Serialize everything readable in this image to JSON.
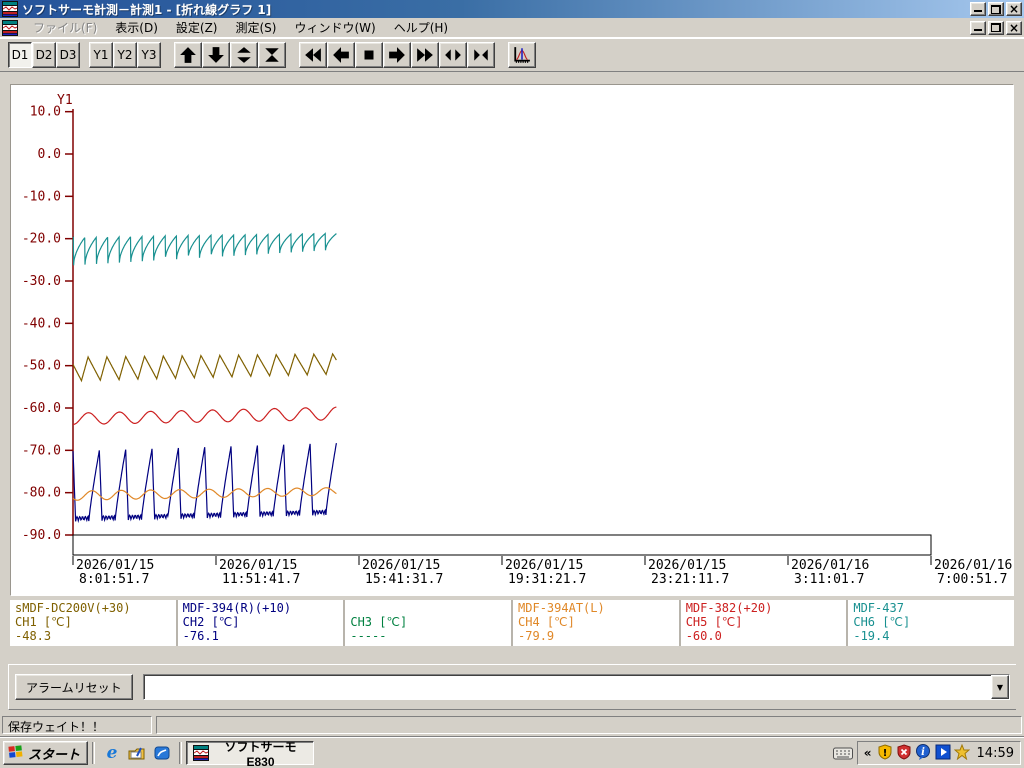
{
  "window": {
    "title": "ソフトサーモ計測－計測1 - [折れ線グラフ 1]"
  },
  "menu": {
    "items": [
      {
        "key": "file",
        "label": "ファイル(F)",
        "enabled": false
      },
      {
        "key": "view",
        "label": "表示(D)",
        "enabled": true
      },
      {
        "key": "settings",
        "label": "設定(Z)",
        "enabled": true
      },
      {
        "key": "measure",
        "label": "測定(S)",
        "enabled": true
      },
      {
        "key": "window",
        "label": "ウィンドウ(W)",
        "enabled": true
      },
      {
        "key": "help",
        "label": "ヘルプ(H)",
        "enabled": true
      }
    ]
  },
  "toolbar": {
    "d_buttons": [
      "D1",
      "D2",
      "D3"
    ],
    "active_d": "D1",
    "y_buttons": [
      "Y1",
      "Y2",
      "Y3"
    ]
  },
  "chart_data": {
    "type": "line",
    "title": "",
    "y_axis": {
      "label": "Y1",
      "max": 10,
      "min": -90,
      "tick_step": 10,
      "color": "#800000",
      "tick_labels": [
        "10.0",
        "0.0",
        "-10.0",
        "-20.0",
        "-30.0",
        "-40.0",
        "-50.0",
        "-60.0",
        "-70.0",
        "-80.0",
        "-90.0"
      ]
    },
    "x_axis": {
      "ticks": [
        {
          "date": "2026/01/15",
          "time": "8:01:51.7"
        },
        {
          "date": "2026/01/15",
          "time": "11:51:41.7"
        },
        {
          "date": "2026/01/15",
          "time": "15:41:31.7"
        },
        {
          "date": "2026/01/15",
          "time": "19:31:21.7"
        },
        {
          "date": "2026/01/15",
          "time": "23:21:11.7"
        },
        {
          "date": "2026/01/16",
          "time": "3:11:01.7"
        },
        {
          "date": "2026/01/16",
          "time": "7:00:51.7"
        }
      ]
    },
    "data_extent_fraction": 0.307,
    "series": [
      {
        "name": "sMDF-DC200V(+30)",
        "channel": "CH1",
        "unit": "℃",
        "color": "#7F6000",
        "current": -48.3,
        "shape": "tri",
        "cycles": 14,
        "rise": 0.35,
        "phase": 0.55,
        "top_start": -48.0,
        "top_end": -47.2,
        "bot_start": -53.6,
        "bot_end": -52.0
      },
      {
        "name": "MDF-394(R)(+10)",
        "channel": "CH2",
        "unit": "℃",
        "color": "#000080",
        "current": -76.1,
        "shape": "pulse",
        "cycles": 10,
        "phase": 0.4,
        "top_start": -70.2,
        "top_end": -68.3,
        "bot_start": -86.8,
        "bot_end": -85.2
      },
      {
        "name": "MDF-394AT(L)",
        "channel": "CH4",
        "unit": "℃",
        "color": "#E08828",
        "current": -79.9,
        "shape": "sine",
        "cycles": 9,
        "phase": 0.6,
        "top_start": -79.6,
        "top_end": -78.8,
        "bot_start": -81.8,
        "bot_end": -80.6
      },
      {
        "name": "MDF-382(+20)",
        "channel": "CH5",
        "unit": "℃",
        "color": "#CC2020",
        "current": -60.0,
        "shape": "sine",
        "cycles": 8.5,
        "phase": 0.75,
        "top_start": -61.2,
        "top_end": -59.8,
        "bot_start": -63.9,
        "bot_end": -62.8
      },
      {
        "name": "MDF-437",
        "channel": "CH6",
        "unit": "℃",
        "color": "#189090",
        "current": -19.4,
        "shape": "saw",
        "cycles": 23,
        "phase": 0.95,
        "top_start": -19.7,
        "top_end": -18.7,
        "bot_start": -26.3,
        "bot_end": -22.6
      }
    ]
  },
  "legend": {
    "cells": [
      {
        "name": "sMDF-DC200V(+30)",
        "label": "CH1 [℃]",
        "value": "-48.3",
        "color": "#7F6000"
      },
      {
        "name": "MDF-394(R)(+10)",
        "label": "CH2 [℃]",
        "value": "-76.1",
        "color": "#000080"
      },
      {
        "name": "",
        "label": "CH3 [℃]",
        "value": "-----",
        "color": "#008040"
      },
      {
        "name": "MDF-394AT(L)",
        "label": "CH4 [℃]",
        "value": "-79.9",
        "color": "#E08828"
      },
      {
        "name": "MDF-382(+20)",
        "label": "CH5 [℃]",
        "value": "-60.0",
        "color": "#CC2020"
      },
      {
        "name": "MDF-437",
        "label": "CH6 [℃]",
        "value": "-19.4",
        "color": "#189090"
      }
    ]
  },
  "alarm": {
    "reset_label": "アラームリセット",
    "combo_value": ""
  },
  "statusbar": {
    "left": "保存ウェイト！！",
    "right": ""
  },
  "taskbar": {
    "start_label": "スタート",
    "app_button": "ソフトサーモ  E830",
    "tray_chevron": "«",
    "tray_time": "14:59"
  }
}
